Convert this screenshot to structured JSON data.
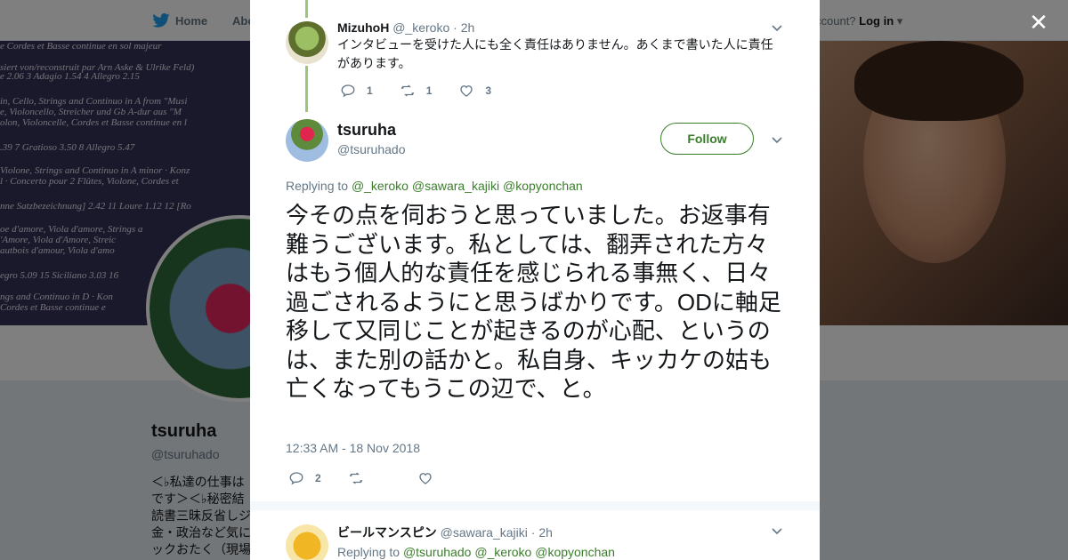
{
  "background": {
    "nav": {
      "home": "Home",
      "about": "Abo",
      "account": "ccount?",
      "login": "Log in"
    },
    "album_lines": [
      "e Cordes et Basse continue en sol majeur",
      "siert von/reconstruit par Arn Aske & Ulrike Feld)",
      "e 2.06  3 Adagio 1.54  4 Allegro 2.15",
      "in, Cello, Strings and Continuo in A from \"Musi",
      "e, Violoncello, Streicher und Gb A-dur aus \"M",
      "olon, Violoncelle, Cordes et Basse continue en l",
      ".39  7 Gratioso 3.50  8 Allegro 5.47",
      "Violone, Strings and Continuo in A minor · Konz",
      "l · Concerto pour 2 Flûtes, Violone, Cordes et",
      "nne Satzbezeichnung] 2.42  11 Loure 1.12  12 [Ro",
      "oe d'amore, Viola d'amore, Strings a",
      "'Amore, Viola d'Amore, Streic",
      "autbois d'amour, Viola d'amo",
      "egro 5.09  15 Siciliano 3.03  16",
      "ngs and Continuo in D · Kon",
      "Cordes et Basse continue e"
    ],
    "profile": {
      "name": "tsuruha",
      "handle": "@tsuruhado",
      "bio_lines": [
        "＜♭私達の仕事は",
        "です＞＜♭秘密結",
        "読書三昧反省しジ",
        "金・政治など気に",
        "ックおたく（現場"
      ]
    }
  },
  "close_icon": "close-icon",
  "reply_above": {
    "name": "MizuhoH",
    "handle": "@_keroko",
    "time": "· 2h",
    "text": "インタビューを受けた人にも全く責任はありません。あくまで書いた人に責任があります。",
    "counts": {
      "replies": "1",
      "retweets": "1",
      "likes": "3"
    }
  },
  "main_tweet": {
    "name": "tsuruha",
    "handle": "@tsuruhado",
    "follow_label": "Follow",
    "replying_label": "Replying to",
    "replying_to": [
      "@_keroko",
      "@sawara_kajiki",
      "@kopyonchan"
    ],
    "text": "今その点を伺おうと思っていました。お返事有難うございます。私としては、翻弄された方々はもう個人的な責任を感じられる事無く、日々過ごされるようにと思うばかりです。ODに軸足移して又同じことが起きるのが心配、というのは、また別の話かと。私自身、キッカケの姑も亡くなってもうこの辺で、と。",
    "timestamp": "12:33 AM - 18 Nov 2018",
    "counts": {
      "replies": "2"
    }
  },
  "reply_below": {
    "name": "ビールマンスピン",
    "handle": "@sawara_kajiki",
    "time": "· 2h",
    "replying_label": "Replying to",
    "replying_to": [
      "@tsuruhado",
      "@_keroko",
      "@kopyonchan"
    ]
  },
  "colors": {
    "accent": "#3a7d2b",
    "thread_line": "#9ac779",
    "muted": "#657786",
    "text": "#14171a"
  }
}
